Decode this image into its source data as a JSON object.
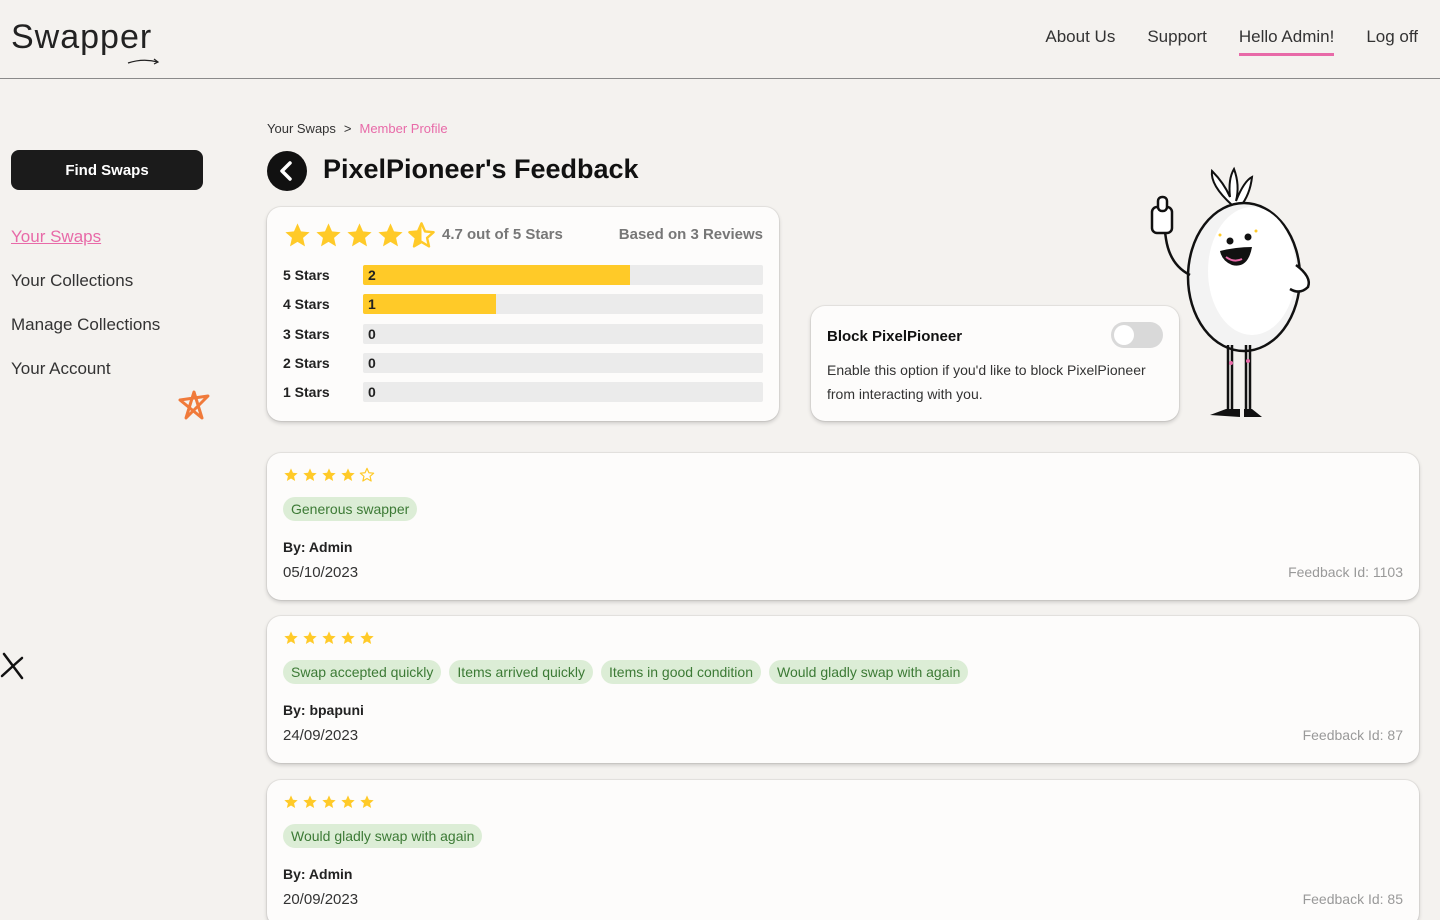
{
  "header": {
    "logo": "Swapper",
    "nav": [
      "About Us",
      "Support",
      "Hello Admin!",
      "Log off"
    ]
  },
  "sidebar": {
    "find_button": "Find Swaps",
    "items": [
      {
        "label": "Your Swaps",
        "active": true
      },
      {
        "label": "Your Collections",
        "active": false
      },
      {
        "label": "Manage Collections",
        "active": false
      },
      {
        "label": "Your Account",
        "active": false
      }
    ]
  },
  "breadcrumb": {
    "items": [
      "Your Swaps",
      "Member Profile"
    ],
    "separator": ">"
  },
  "page_title": "PixelPioneer's Feedback",
  "summary": {
    "average_text": "4.7 out of 5 Stars",
    "average": 4.7,
    "reviews_text": "Based on 3 Reviews",
    "distribution": [
      {
        "label": "5 Stars",
        "count": "2",
        "fraction": 0.667
      },
      {
        "label": "4 Stars",
        "count": "1",
        "fraction": 0.333
      },
      {
        "label": "3 Stars",
        "count": "0",
        "fraction": 0
      },
      {
        "label": "2 Stars",
        "count": "0",
        "fraction": 0
      },
      {
        "label": "1 Stars",
        "count": "0",
        "fraction": 0
      }
    ]
  },
  "block": {
    "title": "Block PixelPioneer",
    "description": "Enable this option if you'd like to block PixelPioneer from interacting with you.",
    "enabled": false
  },
  "reviews": [
    {
      "stars": 4,
      "tags": [
        "Generous swapper"
      ],
      "by": "By: Admin",
      "date": "05/10/2023",
      "id": "Feedback Id: 1103"
    },
    {
      "stars": 5,
      "tags": [
        "Swap accepted quickly",
        "Items arrived quickly",
        "Items in good condition",
        "Would gladly swap with again"
      ],
      "by": "By: bpapuni",
      "date": "24/09/2023",
      "id": "Feedback Id: 87"
    },
    {
      "stars": 5,
      "tags": [
        "Would gladly swap with again"
      ],
      "by": "By: Admin",
      "date": "20/09/2023",
      "id": "Feedback Id: 85"
    }
  ],
  "colors": {
    "accent_pink": "#e86aa8",
    "star_yellow": "#ffca28",
    "tag_bg": "#dcedd6",
    "tag_text": "#3c7a35",
    "button_dark": "#1b1b1b"
  }
}
